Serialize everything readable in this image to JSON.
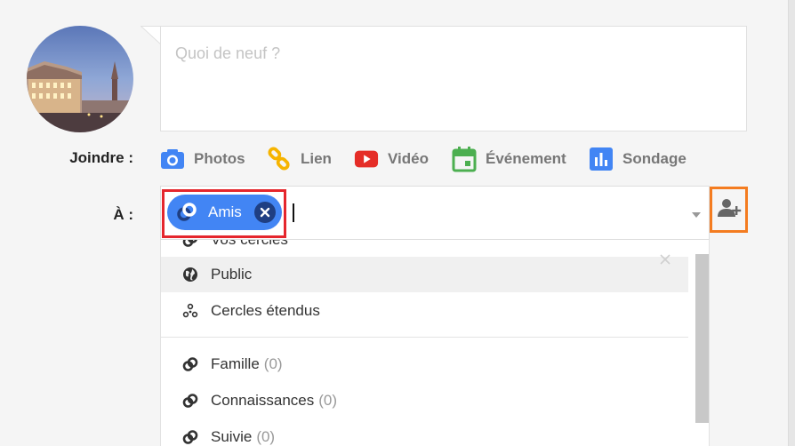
{
  "composer": {
    "placeholder": "Quoi de neuf ?"
  },
  "attach": {
    "label": "Joindre :",
    "items": [
      {
        "label": "Photos",
        "icon": "camera-icon",
        "color": "#4285f4"
      },
      {
        "label": "Lien",
        "icon": "link-icon",
        "color": "#f6b400"
      },
      {
        "label": "Vidéo",
        "icon": "youtube-icon",
        "color": "#e52d27"
      },
      {
        "label": "Événement",
        "icon": "calendar-icon",
        "color": "#4caf50"
      },
      {
        "label": "Sondage",
        "icon": "poll-icon",
        "color": "#4285f4"
      }
    ]
  },
  "audience": {
    "label": "À :",
    "chip_label": "Amis",
    "chip_color": "#4285f4",
    "highlight_color": "#e5262d",
    "add_person_border": "#f47c20"
  },
  "menu": {
    "partial_header": "Vos cercles",
    "items": [
      {
        "label": "Public",
        "icon": "globe-icon",
        "count": ""
      },
      {
        "label": "Cercles étendus",
        "icon": "extended-circles-icon",
        "count": ""
      },
      {
        "label": "Famille",
        "icon": "circle-icon",
        "count": "(0)"
      },
      {
        "label": "Connaissances",
        "icon": "circle-icon",
        "count": "(0)"
      },
      {
        "label": "Suivie",
        "icon": "circle-icon",
        "count": "(0)"
      }
    ]
  }
}
